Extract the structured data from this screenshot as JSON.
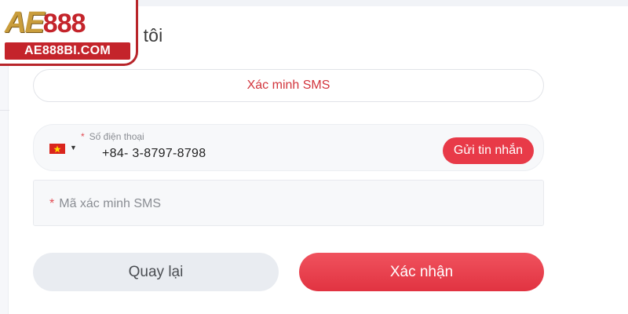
{
  "page": {
    "title": "ủa tôi"
  },
  "logo": {
    "brand_ae": "AE",
    "brand_num": "888",
    "url": "AE888BI.COM"
  },
  "sms_tab": {
    "label": "Xác minh SMS"
  },
  "phone": {
    "label": "Số điện thoại",
    "required_mark": "*",
    "value": "+84- 3-8797-8798",
    "country_flag_icon": "vietnam-flag-icon",
    "send_button": "Gửi tin nhắn"
  },
  "code": {
    "required_mark": "*",
    "placeholder": "Mã xác minh SMS"
  },
  "actions": {
    "back": "Quay lại",
    "confirm": "Xác nhận"
  },
  "colors": {
    "accent": "#e83a48",
    "tab_text": "#d2343c",
    "back_bg": "#e9ecf1"
  }
}
